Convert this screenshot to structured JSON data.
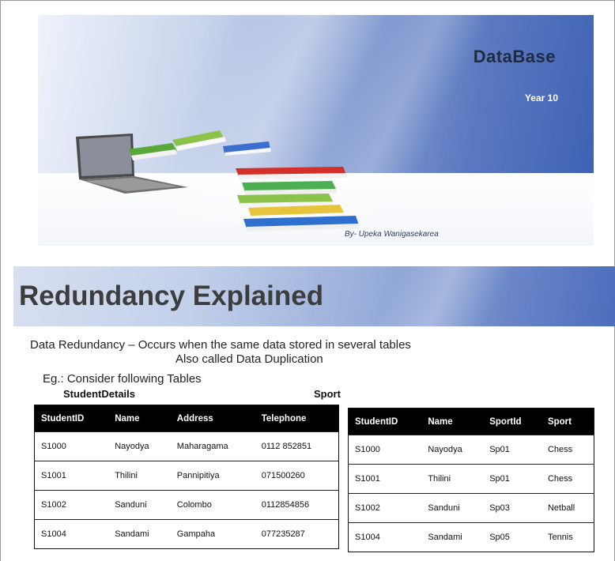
{
  "slide1": {
    "title": "DataBase",
    "subtitle": "Year 10",
    "author": "By- Upeka Wanigasekarea"
  },
  "slide2": {
    "title": "Redundancy Explained",
    "definition_line1": "Data Redundancy –  Occurs when the same data stored in several tables",
    "definition_line2": "Also called Data Duplication",
    "example_line": "Eg.: Consider following Tables",
    "left_caption": "StudentDetails",
    "right_caption": "Sport",
    "student_details": {
      "headers": [
        "StudentID",
        "Name",
        "Address",
        "Telephone"
      ],
      "rows": [
        [
          "S1000",
          "Nayodya",
          "Maharagama",
          "0112 852851"
        ],
        [
          "S1001",
          "Thilini",
          "Pannipitiya",
          "071500260"
        ],
        [
          "S1002",
          "Sanduni",
          "Colombo",
          "0112854856"
        ],
        [
          "S1004",
          "Sandami",
          "Gampaha",
          "077235287"
        ]
      ]
    },
    "sport": {
      "headers": [
        "StudentID",
        "Name",
        "SportId",
        "Sport"
      ],
      "rows": [
        [
          "S1000",
          "Nayodya",
          "Sp01",
          "Chess"
        ],
        [
          "S1001",
          "Thilini",
          "Sp01",
          "Chess"
        ],
        [
          "S1002",
          "Sanduni",
          "Sp03",
          "Netball"
        ],
        [
          "S1004",
          "Sandami",
          "Sp05",
          "Tennis"
        ]
      ]
    }
  },
  "colors": {
    "header_band_dark": "#3f62b4",
    "table_header_bg": "#000000"
  }
}
